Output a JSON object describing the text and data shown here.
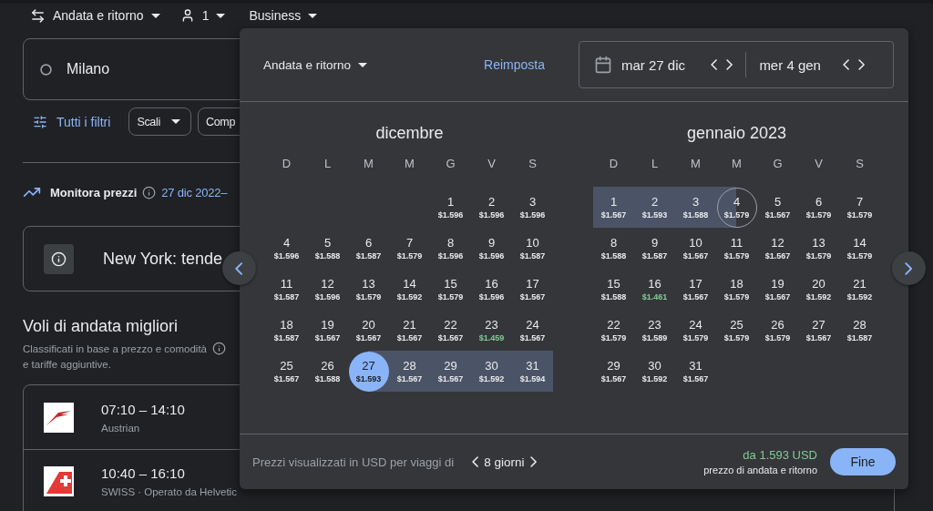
{
  "top_bar": {
    "trip_type": "Andata e ritorno",
    "passengers": "1",
    "cabin": "Business"
  },
  "search": {
    "origin": "Milano"
  },
  "filters": {
    "all_filters": "Tutti i filtri",
    "chips": [
      "Scali",
      "Comp"
    ]
  },
  "price_tracking": {
    "label": "Monitora prezzi",
    "dates": "27 dic 2022–"
  },
  "notice": {
    "text": "New York: tende"
  },
  "results": {
    "title": "Voli di andata migliori",
    "subtitle": "Classificati in base a prezzo e comodità",
    "subtitle_2": "e tariffe aggiuntive.",
    "flights": [
      {
        "times": "07:10 – 14:10",
        "airline": "Austrian"
      },
      {
        "times": "10:40 – 16:10",
        "airline": "SWISS · Operato da Helvetic"
      }
    ]
  },
  "picker": {
    "trip_type": "Andata e ritorno",
    "reset": "Reimposta",
    "departure": "mar 27 dic",
    "return": "mer 4 gen",
    "months": [
      {
        "title": "dicembre",
        "weekdays": [
          "D",
          "L",
          "M",
          "M",
          "G",
          "V",
          "S"
        ],
        "weeks": [
          [
            {
              "day": "1",
              "price": "$1.596",
              "cheap": false,
              "in_range": false,
              "selected": false
            },
            {
              "day": "2",
              "price": "$1.596",
              "cheap": false,
              "in_range": false,
              "selected": false
            },
            {
              "day": "3",
              "price": "$1.596",
              "cheap": false,
              "in_range": false,
              "selected": false
            }
          ],
          [
            {
              "day": "4",
              "price": "$1.596",
              "cheap": false,
              "in_range": false,
              "selected": false
            },
            {
              "day": "5",
              "price": "$1.588",
              "cheap": false,
              "in_range": false,
              "selected": false
            },
            {
              "day": "6",
              "price": "$1.587",
              "cheap": false,
              "in_range": false,
              "selected": false
            },
            {
              "day": "7",
              "price": "$1.579",
              "cheap": false,
              "in_range": false,
              "selected": false
            },
            {
              "day": "8",
              "price": "$1.596",
              "cheap": false,
              "in_range": false,
              "selected": false
            },
            {
              "day": "9",
              "price": "$1.596",
              "cheap": false,
              "in_range": false,
              "selected": false
            },
            {
              "day": "10",
              "price": "$1.587",
              "cheap": false,
              "in_range": false,
              "selected": false
            }
          ],
          [
            {
              "day": "11",
              "price": "$1.587",
              "cheap": false,
              "in_range": false,
              "selected": false
            },
            {
              "day": "12",
              "price": "$1.596",
              "cheap": false,
              "in_range": false,
              "selected": false
            },
            {
              "day": "13",
              "price": "$1.579",
              "cheap": false,
              "in_range": false,
              "selected": false
            },
            {
              "day": "14",
              "price": "$1.592",
              "cheap": false,
              "in_range": false,
              "selected": false
            },
            {
              "day": "15",
              "price": "$1.579",
              "cheap": false,
              "in_range": false,
              "selected": false
            },
            {
              "day": "16",
              "price": "$1.596",
              "cheap": false,
              "in_range": false,
              "selected": false
            },
            {
              "day": "17",
              "price": "$1.567",
              "cheap": false,
              "in_range": false,
              "selected": false
            }
          ],
          [
            {
              "day": "18",
              "price": "$1.587",
              "cheap": false,
              "in_range": false,
              "selected": false
            },
            {
              "day": "19",
              "price": "$1.567",
              "cheap": false,
              "in_range": false,
              "selected": false
            },
            {
              "day": "20",
              "price": "$1.567",
              "cheap": false,
              "in_range": false,
              "selected": false
            },
            {
              "day": "21",
              "price": "$1.567",
              "cheap": false,
              "in_range": false,
              "selected": false
            },
            {
              "day": "22",
              "price": "$1.567",
              "cheap": false,
              "in_range": false,
              "selected": false
            },
            {
              "day": "23",
              "price": "$1.459",
              "cheap": true,
              "in_range": false,
              "selected": false
            },
            {
              "day": "24",
              "price": "$1.567",
              "cheap": false,
              "in_range": false,
              "selected": false
            }
          ],
          [
            {
              "day": "25",
              "price": "$1.567",
              "cheap": false,
              "in_range": false,
              "selected": false
            },
            {
              "day": "26",
              "price": "$1.588",
              "cheap": false,
              "in_range": false,
              "selected": false
            },
            {
              "day": "27",
              "price": "$1.593",
              "cheap": false,
              "in_range": false,
              "selected": true
            },
            {
              "day": "28",
              "price": "$1.567",
              "cheap": false,
              "in_range": true,
              "selected": false
            },
            {
              "day": "29",
              "price": "$1.567",
              "cheap": false,
              "in_range": true,
              "selected": false
            },
            {
              "day": "30",
              "price": "$1.592",
              "cheap": false,
              "in_range": true,
              "selected": false
            },
            {
              "day": "31",
              "price": "$1.594",
              "cheap": false,
              "in_range": true,
              "selected": false
            }
          ]
        ]
      },
      {
        "title": "gennaio 2023",
        "weekdays": [
          "D",
          "L",
          "M",
          "M",
          "G",
          "V",
          "S"
        ],
        "weeks": [
          [
            {
              "day": "1",
              "price": "$1.567",
              "cheap": false,
              "in_range": true,
              "selected": false
            },
            {
              "day": "2",
              "price": "$1.593",
              "cheap": false,
              "in_range": true,
              "selected": false
            },
            {
              "day": "3",
              "price": "$1.588",
              "cheap": false,
              "in_range": true,
              "selected": false
            },
            {
              "day": "4",
              "price": "$1.579",
              "cheap": false,
              "in_range": false,
              "selected": true
            },
            {
              "day": "5",
              "price": "$1.567",
              "cheap": false,
              "in_range": false,
              "selected": false
            },
            {
              "day": "6",
              "price": "$1.579",
              "cheap": false,
              "in_range": false,
              "selected": false
            },
            {
              "day": "7",
              "price": "$1.579",
              "cheap": false,
              "in_range": false,
              "selected": false
            }
          ],
          [
            {
              "day": "8",
              "price": "$1.588",
              "cheap": false,
              "in_range": false,
              "selected": false
            },
            {
              "day": "9",
              "price": "$1.587",
              "cheap": false,
              "in_range": false,
              "selected": false
            },
            {
              "day": "10",
              "price": "$1.567",
              "cheap": false,
              "in_range": false,
              "selected": false
            },
            {
              "day": "11",
              "price": "$1.579",
              "cheap": false,
              "in_range": false,
              "selected": false
            },
            {
              "day": "12",
              "price": "$1.567",
              "cheap": false,
              "in_range": false,
              "selected": false
            },
            {
              "day": "13",
              "price": "$1.579",
              "cheap": false,
              "in_range": false,
              "selected": false
            },
            {
              "day": "14",
              "price": "$1.579",
              "cheap": false,
              "in_range": false,
              "selected": false
            }
          ],
          [
            {
              "day": "15",
              "price": "$1.588",
              "cheap": false,
              "in_range": false,
              "selected": false
            },
            {
              "day": "16",
              "price": "$1.461",
              "cheap": true,
              "in_range": false,
              "selected": false
            },
            {
              "day": "17",
              "price": "$1.567",
              "cheap": false,
              "in_range": false,
              "selected": false
            },
            {
              "day": "18",
              "price": "$1.579",
              "cheap": false,
              "in_range": false,
              "selected": false
            },
            {
              "day": "19",
              "price": "$1.567",
              "cheap": false,
              "in_range": false,
              "selected": false
            },
            {
              "day": "20",
              "price": "$1.592",
              "cheap": false,
              "in_range": false,
              "selected": false
            },
            {
              "day": "21",
              "price": "$1.592",
              "cheap": false,
              "in_range": false,
              "selected": false
            }
          ],
          [
            {
              "day": "22",
              "price": "$1.579",
              "cheap": false,
              "in_range": false,
              "selected": false
            },
            {
              "day": "23",
              "price": "$1.589",
              "cheap": false,
              "in_range": false,
              "selected": false
            },
            {
              "day": "24",
              "price": "$1.579",
              "cheap": false,
              "in_range": false,
              "selected": false
            },
            {
              "day": "25",
              "price": "$1.579",
              "cheap": false,
              "in_range": false,
              "selected": false
            },
            {
              "day": "26",
              "price": "$1.579",
              "cheap": false,
              "in_range": false,
              "selected": false
            },
            {
              "day": "27",
              "price": "$1.567",
              "cheap": false,
              "in_range": false,
              "selected": false
            },
            {
              "day": "28",
              "price": "$1.587",
              "cheap": false,
              "in_range": false,
              "selected": false
            }
          ],
          [
            {
              "day": "29",
              "price": "$1.567",
              "cheap": false,
              "in_range": false,
              "selected": false
            },
            {
              "day": "30",
              "price": "$1.592",
              "cheap": false,
              "in_range": false,
              "selected": false
            },
            {
              "day": "31",
              "price": "$1.567",
              "cheap": false,
              "in_range": false,
              "selected": false
            }
          ]
        ]
      }
    ],
    "footer": {
      "note": "Prezzi visualizzati in USD per viaggi di",
      "duration": "8 giorni",
      "price": "da 1.593 USD",
      "price_note": "prezzo di andata e ritorno",
      "done": "Fine"
    }
  }
}
